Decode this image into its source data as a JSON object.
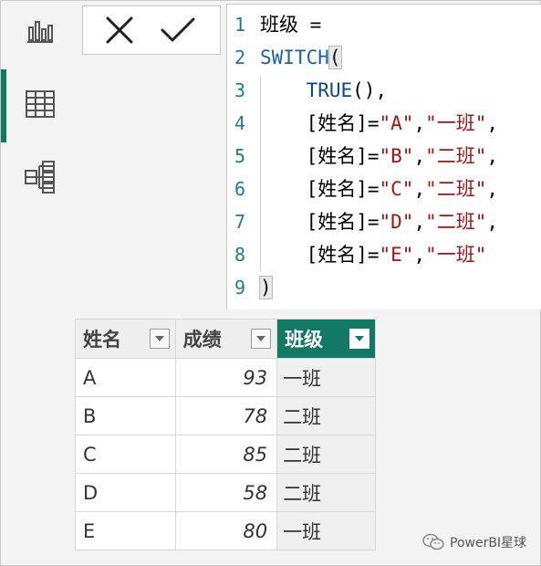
{
  "rail": {
    "items": [
      {
        "name": "report-view",
        "icon": "bar-chart-icon",
        "active": false
      },
      {
        "name": "table-view",
        "icon": "table-grid-icon",
        "active": true
      },
      {
        "name": "model-view",
        "icon": "model-diagram-icon",
        "active": false
      }
    ],
    "accent": "#117865"
  },
  "formula_bar": {
    "cancel_icon": "close-icon",
    "commit_icon": "checkmark-icon",
    "lines": [
      {
        "n": "1",
        "parts": [
          {
            "t": "班级 =",
            "c": "op"
          }
        ]
      },
      {
        "n": "2",
        "parts": [
          {
            "t": "SWITCH",
            "c": "kw"
          },
          {
            "t": "(",
            "c": "bracket-hl"
          }
        ]
      },
      {
        "n": "3",
        "parts": [
          {
            "t": "    TRUE",
            "c": "fn"
          },
          {
            "t": "(),",
            "c": "op"
          }
        ]
      },
      {
        "n": "4",
        "parts": [
          {
            "t": "    [姓名]=",
            "c": "op"
          },
          {
            "t": "\"A\"",
            "c": "str"
          },
          {
            "t": ",",
            "c": "op"
          },
          {
            "t": "\"一班\"",
            "c": "str"
          },
          {
            "t": ",",
            "c": "op"
          }
        ]
      },
      {
        "n": "5",
        "parts": [
          {
            "t": "    [姓名]=",
            "c": "op"
          },
          {
            "t": "\"B\"",
            "c": "str"
          },
          {
            "t": ",",
            "c": "op"
          },
          {
            "t": "\"二班\"",
            "c": "str"
          },
          {
            "t": ",",
            "c": "op"
          }
        ]
      },
      {
        "n": "6",
        "parts": [
          {
            "t": "    [姓名]=",
            "c": "op"
          },
          {
            "t": "\"C\"",
            "c": "str"
          },
          {
            "t": ",",
            "c": "op"
          },
          {
            "t": "\"二班\"",
            "c": "str"
          },
          {
            "t": ",",
            "c": "op"
          }
        ]
      },
      {
        "n": "7",
        "parts": [
          {
            "t": "    [姓名]=",
            "c": "op"
          },
          {
            "t": "\"D\"",
            "c": "str"
          },
          {
            "t": ",",
            "c": "op"
          },
          {
            "t": "\"二班\"",
            "c": "str"
          },
          {
            "t": ",",
            "c": "op"
          }
        ]
      },
      {
        "n": "8",
        "parts": [
          {
            "t": "    [姓名]=",
            "c": "op"
          },
          {
            "t": "\"E\"",
            "c": "str"
          },
          {
            "t": ",",
            "c": "op"
          },
          {
            "t": "\"一班\"",
            "c": "str"
          }
        ]
      },
      {
        "n": "9",
        "parts": [
          {
            "t": ")",
            "c": "bracket-hl"
          }
        ]
      }
    ]
  },
  "table": {
    "columns": [
      {
        "label": "姓名",
        "selected": false
      },
      {
        "label": "成绩",
        "selected": false
      },
      {
        "label": "班级",
        "selected": true
      }
    ],
    "rows": [
      [
        "A",
        "93",
        "一班"
      ],
      [
        "B",
        "78",
        "二班"
      ],
      [
        "C",
        "85",
        "二班"
      ],
      [
        "D",
        "58",
        "二班"
      ],
      [
        "E",
        "80",
        "一班"
      ]
    ]
  },
  "watermark": {
    "text": "PowerBI星球",
    "icon": "wechat-icon"
  }
}
